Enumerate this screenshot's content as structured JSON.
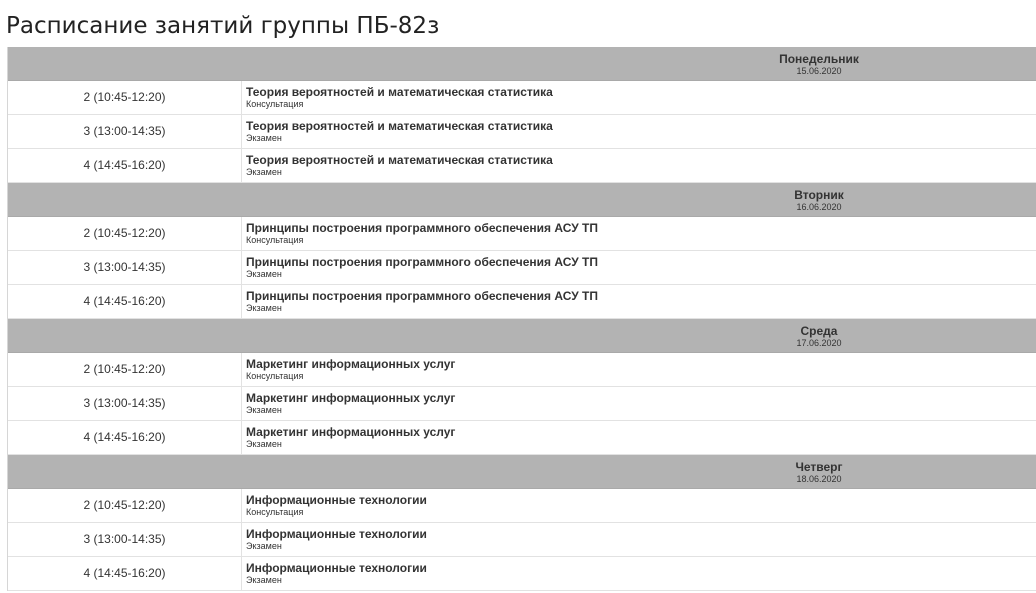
{
  "page": {
    "title": "Расписание занятий группы ПБ-82з"
  },
  "days": [
    {
      "name": "Понедельник",
      "date": "15.06.2020",
      "lessons": [
        {
          "time": "2 (10:45-12:20)",
          "subject": "Теория вероятностей и математическая статистика",
          "type": "Консультация"
        },
        {
          "time": "3 (13:00-14:35)",
          "subject": "Теория вероятностей и математическая статистика",
          "type": "Экзамен"
        },
        {
          "time": "4 (14:45-16:20)",
          "subject": "Теория вероятностей и математическая статистика",
          "type": "Экзамен"
        }
      ]
    },
    {
      "name": "Вторник",
      "date": "16.06.2020",
      "lessons": [
        {
          "time": "2 (10:45-12:20)",
          "subject": "Принципы построения программного обеспечения АСУ ТП",
          "type": "Консультация"
        },
        {
          "time": "3 (13:00-14:35)",
          "subject": "Принципы построения программного обеспечения АСУ ТП",
          "type": "Экзамен"
        },
        {
          "time": "4 (14:45-16:20)",
          "subject": "Принципы построения программного обеспечения АСУ ТП",
          "type": "Экзамен"
        }
      ]
    },
    {
      "name": "Среда",
      "date": "17.06.2020",
      "lessons": [
        {
          "time": "2 (10:45-12:20)",
          "subject": "Маркетинг информационных услуг",
          "type": "Консультация"
        },
        {
          "time": "3 (13:00-14:35)",
          "subject": "Маркетинг информационных услуг",
          "type": "Экзамен"
        },
        {
          "time": "4 (14:45-16:20)",
          "subject": "Маркетинг информационных услуг",
          "type": "Экзамен"
        }
      ]
    },
    {
      "name": "Четверг",
      "date": "18.06.2020",
      "lessons": [
        {
          "time": "2 (10:45-12:20)",
          "subject": "Информационные технологии",
          "type": "Консультация"
        },
        {
          "time": "3 (13:00-14:35)",
          "subject": "Информационные технологии",
          "type": "Экзамен"
        },
        {
          "time": "4 (14:45-16:20)",
          "subject": "Информационные технологии",
          "type": "Экзамен"
        }
      ]
    }
  ]
}
